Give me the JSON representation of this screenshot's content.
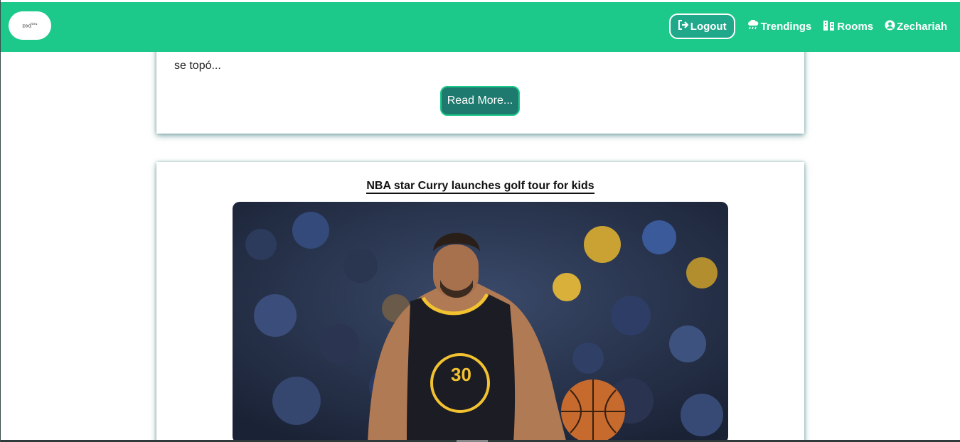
{
  "header": {
    "logo_text": "zed",
    "logo_sup": "tex",
    "logout_label": "Logout",
    "nav": [
      {
        "label": "Trendings",
        "icon": "cloud-rain-icon"
      },
      {
        "label": "Rooms",
        "icon": "building-icon"
      },
      {
        "label": "Zechariah",
        "icon": "user-circle-icon"
      }
    ]
  },
  "cards": [
    {
      "excerpt": "se topó...",
      "read_more_label": "Read More..."
    },
    {
      "title": "NBA star Curry launches golf tour for kids",
      "image_alt": "NBA player number 30 dribbling a basketball"
    }
  ],
  "colors": {
    "header_bg": "#1cc98b",
    "button_bg": "#1e7a6f",
    "button_border": "#1cc98b"
  }
}
